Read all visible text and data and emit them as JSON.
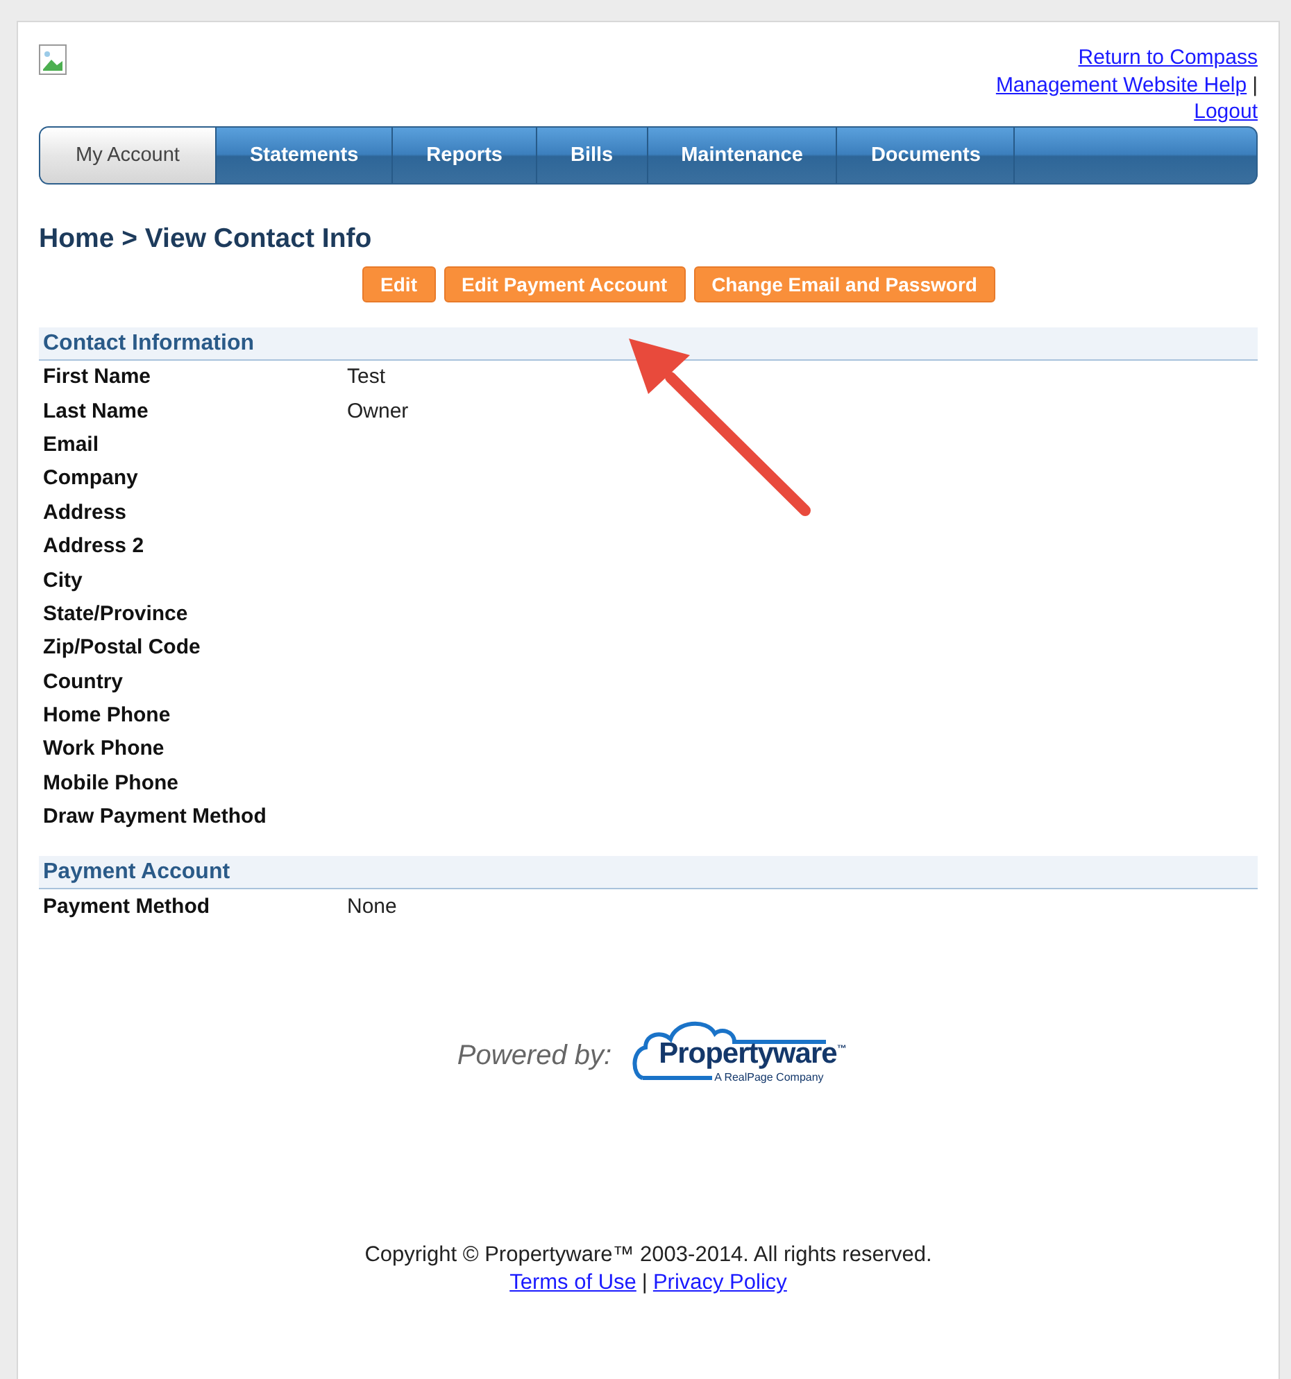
{
  "header_links": [
    {
      "label": "Return to Compass"
    },
    {
      "label": "Management Website Help",
      "separator": "|"
    },
    {
      "label": "Logout"
    }
  ],
  "tabs": [
    {
      "label": "My Account",
      "selected": true
    },
    {
      "label": "Statements",
      "selected": false
    },
    {
      "label": "Reports",
      "selected": false
    },
    {
      "label": "Bills",
      "selected": false
    },
    {
      "label": "Maintenance",
      "selected": false
    },
    {
      "label": "Documents",
      "selected": false
    }
  ],
  "breadcrumb": "Home > View Contact Info",
  "actions": [
    "Edit",
    "Edit Payment Account",
    "Change Email and Password"
  ],
  "sections": [
    {
      "title": "Contact Information",
      "rows": [
        {
          "label": "First Name",
          "value": "Test"
        },
        {
          "label": "Last Name",
          "value": "Owner"
        },
        {
          "label": "Email"
        },
        {
          "label": "Company"
        },
        {
          "label": "Address"
        },
        {
          "label": "Address 2"
        },
        {
          "label": "City"
        },
        {
          "label": "State/Province"
        },
        {
          "label": "Zip/Postal Code"
        },
        {
          "label": "Country"
        },
        {
          "label": "Home Phone"
        },
        {
          "label": "Work Phone"
        },
        {
          "label": "Mobile Phone"
        },
        {
          "label": "Draw Payment Method"
        }
      ]
    },
    {
      "title": "Payment Account",
      "rows": [
        {
          "label": "Payment Method",
          "value": "None"
        }
      ]
    }
  ],
  "powered_by": {
    "label": "Powered by:",
    "logo_name": "Propertyware$^{™}$",
    "logo_tagline": "A RealPage Company"
  },
  "footer": {
    "copyright": "Copyright © Propertyware™ 2003-2014. All rights reserved.",
    "links": [
      "Terms of Use",
      "Privacy Policy"
    ],
    "separator": "|"
  }
}
